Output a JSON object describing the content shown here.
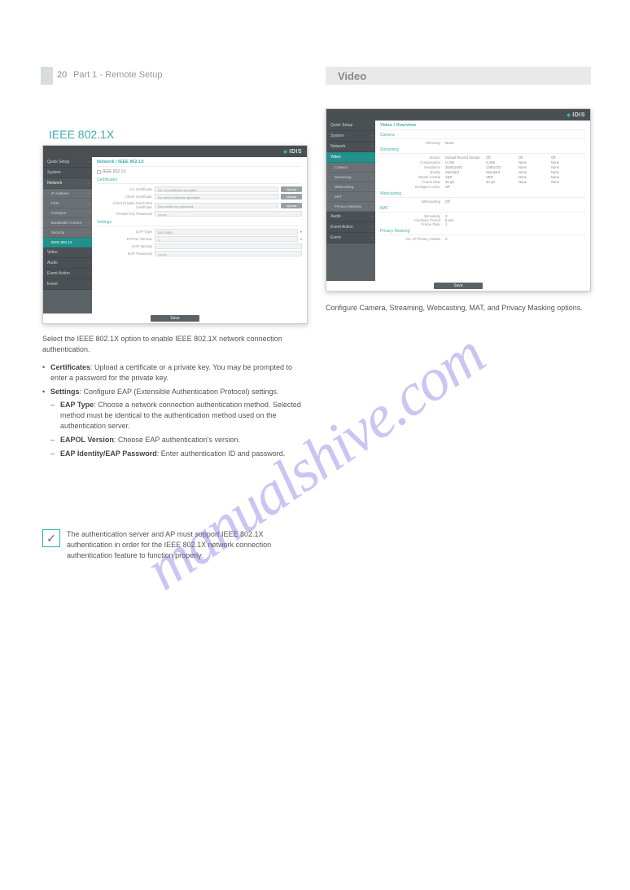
{
  "page": {
    "number": "20",
    "chapter": "Part 1 - Remote Setup"
  },
  "left_section": {
    "title": "IEEE 802.1X",
    "right_header": "Video",
    "intro": "Select the IEEE 802.1X option to enable IEEE 802.1X network connection authentication.",
    "bullets": {
      "certificates": {
        "label": "Certificates",
        "text": ": Upload a certificate or a private key. You may be prompted to enter a password for the private key."
      },
      "settings": {
        "label": "Settings",
        "text": ": Configure EAP (Extensible Authentication Protocol) settings.",
        "children": {
          "eap_type": {
            "label": "EAP Type",
            "text": ": Choose a network connection authentication method. Selected method must be identical to the authentication method used on the authentication server."
          },
          "eapol_version": {
            "label": "EAPOL Version",
            "text": ": Choose EAP authentication's version."
          },
          "eap_identity": {
            "label": "EAP Identity/EAP Password",
            "text": ": Enter authentication ID and password."
          }
        }
      }
    },
    "note": "The authentication server and AP must support IEEE 802.1X authentication in order for the IEEE 802.1X network connection authentication feature to function properly."
  },
  "screenshot_left": {
    "brand": "IDIS",
    "breadcrumb": "Network / IEEE 802.1X",
    "checkbox_label": "IEEE 802.1X",
    "sidebar": {
      "items": [
        {
          "label": "Quick Setup",
          "type": "dark"
        },
        {
          "label": "System",
          "type": "dark"
        },
        {
          "label": "Network",
          "type": "parent-sel"
        },
        {
          "label": "IP Address",
          "type": "child"
        },
        {
          "label": "FEN",
          "type": "child"
        },
        {
          "label": "Port/QoS",
          "type": "child"
        },
        {
          "label": "Bandwidth Control",
          "type": "child"
        },
        {
          "label": "Security",
          "type": "child"
        },
        {
          "label": "IEEE 802.1X",
          "type": "active-teal"
        },
        {
          "label": "Video",
          "type": "dark"
        },
        {
          "label": "Audio",
          "type": "dark"
        },
        {
          "label": "Event Action",
          "type": "dark"
        },
        {
          "label": "Event",
          "type": "dark"
        }
      ]
    },
    "cert_group": "Certificates",
    "cert_rows": [
      {
        "label": "CA Certificate",
        "value": "No CA certificate uploaded.",
        "button": "Upload"
      },
      {
        "label": "Client Certificate",
        "value": "No client certificate uploaded.",
        "button": "Upload"
      },
      {
        "label": "Client Private Key/Client Certificate",
        "value": "No private key uploaded.",
        "button": "Upload"
      },
      {
        "label": "Private Key Password",
        "value": "••••••••",
        "button": ""
      }
    ],
    "settings_group": "Settings",
    "settings_rows": [
      {
        "label": "EAP Type",
        "value": "EAP-MD5"
      },
      {
        "label": "EAPOL Version",
        "value": "1"
      },
      {
        "label": "EAP Identity",
        "value": ""
      },
      {
        "label": "EAP Password",
        "value": "••••••••"
      }
    ],
    "save": "Save"
  },
  "screenshot_right": {
    "brand": "IDIS",
    "breadcrumb": "Video / Overview",
    "sidebar": {
      "items": [
        {
          "label": "Quick Setup",
          "type": "dark"
        },
        {
          "label": "System",
          "type": "dark"
        },
        {
          "label": "Network",
          "type": "dark"
        },
        {
          "label": "Video",
          "type": "active-teal"
        },
        {
          "label": "Camera",
          "type": "child expanded"
        },
        {
          "label": "Streaming",
          "type": "child expanded"
        },
        {
          "label": "Webcasting",
          "type": "child expanded"
        },
        {
          "label": "MAT",
          "type": "child expanded"
        },
        {
          "label": "Privacy Masking",
          "type": "child expanded"
        },
        {
          "label": "Audio",
          "type": "dark"
        },
        {
          "label": "Event Action",
          "type": "dark"
        },
        {
          "label": "Event",
          "type": "dark"
        }
      ]
    },
    "camera_section": "Camera",
    "camera_kv": {
      "label": "Mirroring",
      "value": "None"
    },
    "streaming_section": "Streaming",
    "table": {
      "headers": [
        "Stream",
        "Default Record Stream",
        "Off",
        "Off",
        "Off"
      ],
      "rows": [
        {
          "label": "Compression",
          "c1": "H.265",
          "c2": "H.265",
          "c3": "None",
          "c4": "None"
        },
        {
          "label": "Resolution",
          "c1": "3840x2400",
          "c2": "1280x720",
          "c3": "None",
          "c4": "None"
        },
        {
          "label": "Quality",
          "c1": "Standard",
          "c2": "Standard",
          "c3": "None",
          "c4": "None"
        },
        {
          "label": "Bitrate Control",
          "c1": "VBR",
          "c2": "VBR",
          "c3": "None",
          "c4": "None"
        },
        {
          "label": "Frame Rate",
          "c1": "30 ips",
          "c2": "30 ips",
          "c3": "None",
          "c4": "None"
        },
        {
          "label": "Intelligent Codec",
          "c1": "Off",
          "c2": "",
          "c3": "",
          "c4": ""
        }
      ]
    },
    "webcasting_section": "Webcasting",
    "webcasting_kv": {
      "label": "Webcasting",
      "value": "Off"
    },
    "mat_section": "MAT",
    "mat_rows": [
      {
        "label": "Sensitivity",
        "value": "3"
      },
      {
        "label": "Inactivity Period",
        "value": "5 sec."
      },
      {
        "label": "Frame Rate",
        "value": "1"
      }
    ],
    "privacy_section": "Privacy Masking",
    "privacy_kv": {
      "label": "No. of Privacy Masks",
      "value": "0"
    },
    "save": "Save"
  },
  "right_body": {
    "text": "Configure Camera, Streaming, Webcasting, MAT, and Privacy Masking options."
  }
}
